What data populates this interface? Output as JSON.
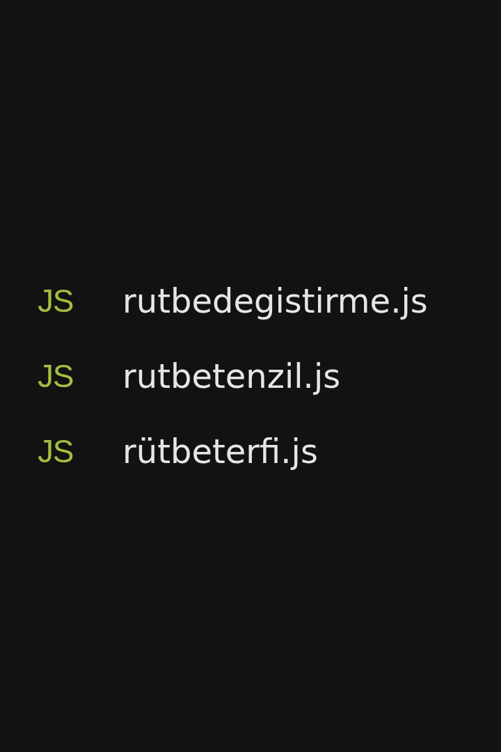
{
  "files": [
    {
      "type_label": "JS",
      "name": "rutbedegistirme.js"
    },
    {
      "type_label": "JS",
      "name": "rutbetenzil.js"
    },
    {
      "type_label": "JS",
      "name": "rütbeterfi.js"
    }
  ]
}
